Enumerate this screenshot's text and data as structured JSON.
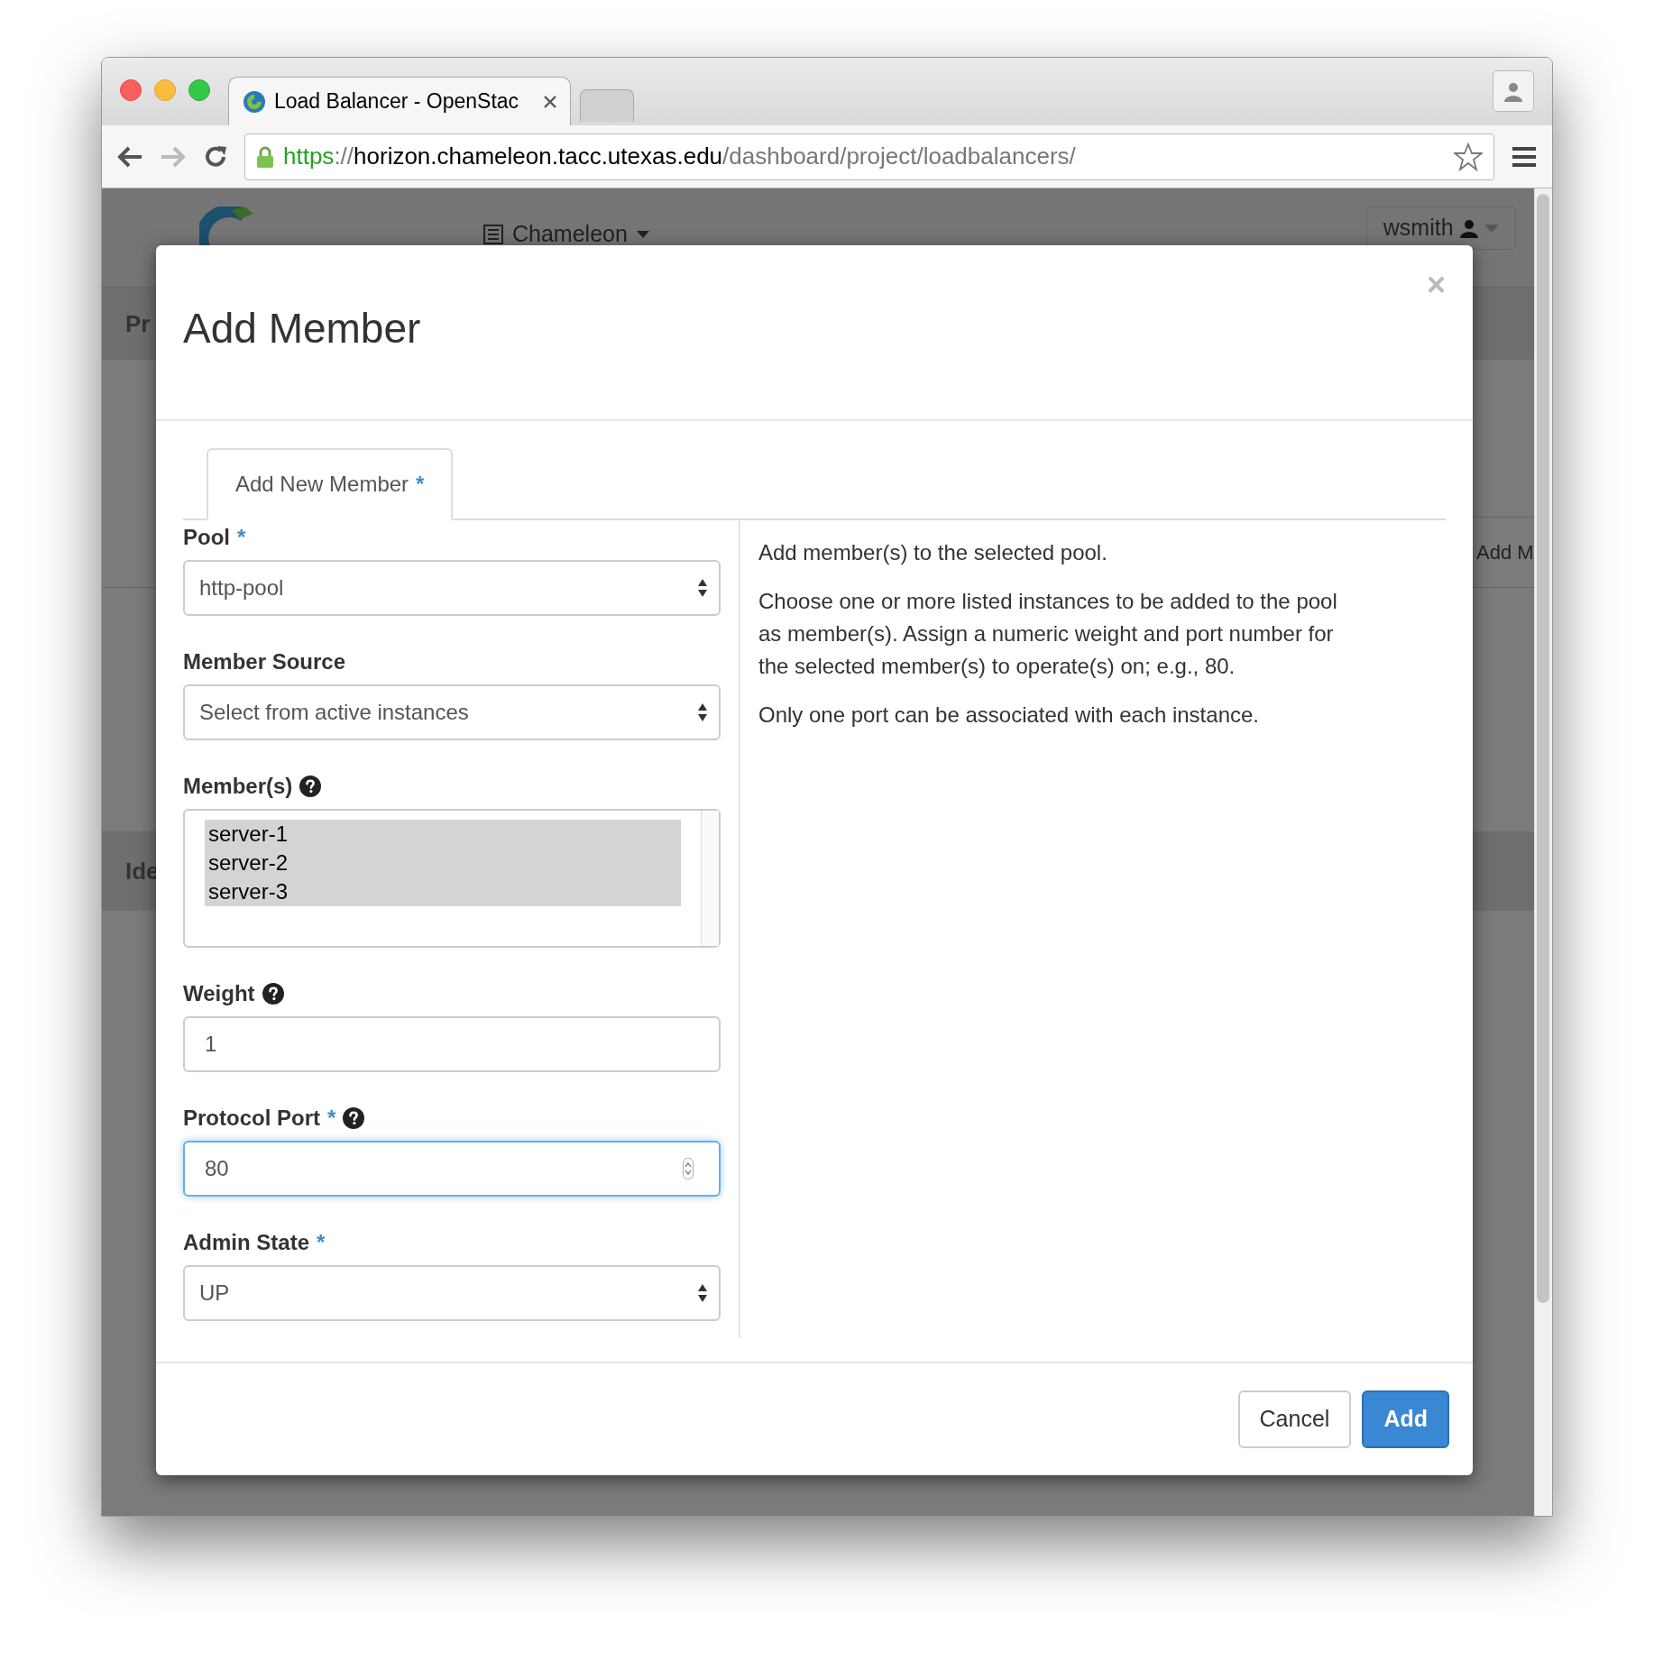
{
  "browser": {
    "tabs": [
      {
        "kind": "page",
        "title": "Load Balancer - OpenStac",
        "selected": true
      },
      {
        "kind": "new",
        "selected": false
      }
    ],
    "address": {
      "scheme": "https",
      "separator": "://",
      "host": "horizon.chameleon.tacc.utexas.edu",
      "path": "/dashboard/project/loadbalancers/"
    }
  },
  "background_page": {
    "project_menu": "Chameleon",
    "user_menu": "wsmith",
    "section_1": "Pr",
    "section_2": "Ide",
    "action": "Add M"
  },
  "modal": {
    "title": "Add Member",
    "close": "×",
    "tab": {
      "label": "Add New Member",
      "required_mark": "*",
      "selected": true
    },
    "fields": [
      {
        "kind": "select",
        "label": "Pool",
        "required_mark": "*",
        "help": false,
        "value": "http-pool"
      },
      {
        "kind": "select",
        "label": "Member Source",
        "help": false,
        "value": "Select from active instances"
      },
      {
        "kind": "multiselect",
        "label": "Member(s)",
        "help": true,
        "options": [
          {
            "label": "server-1",
            "selected": true
          },
          {
            "label": "server-2",
            "selected": true
          },
          {
            "label": "server-3",
            "selected": true
          }
        ]
      },
      {
        "kind": "text",
        "label": "Weight",
        "help": true,
        "value": "1",
        "focused": false
      },
      {
        "kind": "number",
        "label": "Protocol Port",
        "required_mark": "*",
        "help": true,
        "value": "80",
        "focused": true
      },
      {
        "kind": "select",
        "label": "Admin State",
        "required_mark": "*",
        "help": false,
        "value": "UP"
      }
    ],
    "help_text": [
      "Add member(s) to the selected pool.",
      "Choose one or more listed instances to be added to the pool as member(s). Assign a numeric weight and port number for the selected member(s) to operate(s) on; e.g., 80.",
      "Only one port can be associated with each instance."
    ],
    "buttons": [
      {
        "kind": "default",
        "label": "Cancel"
      },
      {
        "kind": "primary",
        "label": "Add"
      }
    ]
  }
}
